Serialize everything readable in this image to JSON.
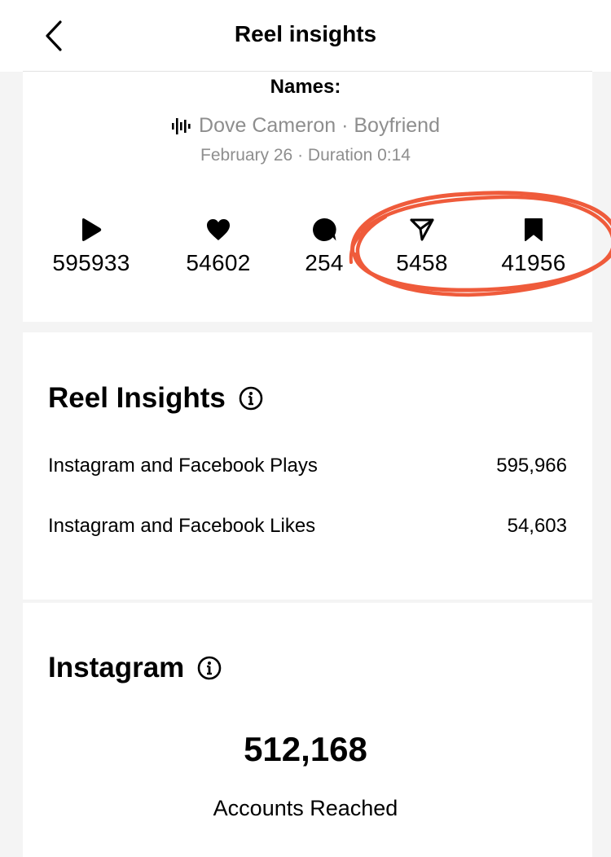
{
  "header": {
    "title": "Reel insights",
    "back_icon": "chevron-left-icon"
  },
  "reel": {
    "names_label": "Names:",
    "audio_icon": "audio-waveform-icon",
    "audio": "Dove Cameron · Boyfriend",
    "meta": "February 26 · Duration 0:14"
  },
  "stats": {
    "plays": {
      "icon": "play-icon",
      "value": "595933"
    },
    "likes": {
      "icon": "heart-icon",
      "value": "54602"
    },
    "comments": {
      "icon": "comment-icon",
      "value": "254"
    },
    "shares": {
      "icon": "send-icon",
      "value": "5458"
    },
    "saves": {
      "icon": "bookmark-icon",
      "value": "41956"
    }
  },
  "annotation": {
    "shape": "hand-drawn circle",
    "color": "#ef5b3b"
  },
  "reel_insights": {
    "title": "Reel Insights",
    "info_icon": "info-icon",
    "rows": [
      {
        "label": "Instagram and Facebook Plays",
        "value": "595,966"
      },
      {
        "label": "Instagram and Facebook Likes",
        "value": "54,603"
      }
    ]
  },
  "instagram": {
    "title": "Instagram",
    "info_icon": "info-icon",
    "accounts_reached": "512,168",
    "accounts_reached_label": "Accounts Reached"
  }
}
